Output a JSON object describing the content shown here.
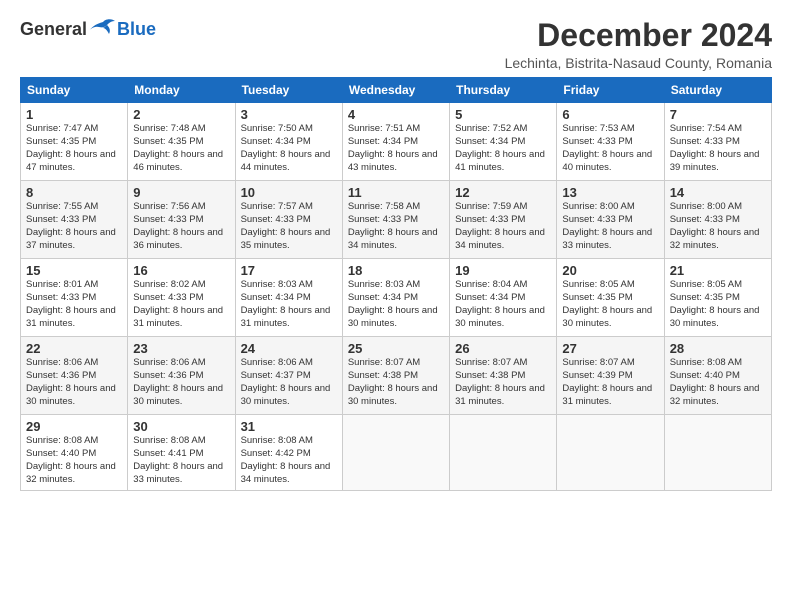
{
  "header": {
    "logo_general": "General",
    "logo_blue": "Blue",
    "month_title": "December 2024",
    "location": "Lechinta, Bistrita-Nasaud County, Romania"
  },
  "days_of_week": [
    "Sunday",
    "Monday",
    "Tuesday",
    "Wednesday",
    "Thursday",
    "Friday",
    "Saturday"
  ],
  "weeks": [
    [
      {
        "day": 1,
        "sunrise": "7:47 AM",
        "sunset": "4:35 PM",
        "daylight": "8 hours and 47 minutes."
      },
      {
        "day": 2,
        "sunrise": "7:48 AM",
        "sunset": "4:35 PM",
        "daylight": "8 hours and 46 minutes."
      },
      {
        "day": 3,
        "sunrise": "7:50 AM",
        "sunset": "4:34 PM",
        "daylight": "8 hours and 44 minutes."
      },
      {
        "day": 4,
        "sunrise": "7:51 AM",
        "sunset": "4:34 PM",
        "daylight": "8 hours and 43 minutes."
      },
      {
        "day": 5,
        "sunrise": "7:52 AM",
        "sunset": "4:34 PM",
        "daylight": "8 hours and 41 minutes."
      },
      {
        "day": 6,
        "sunrise": "7:53 AM",
        "sunset": "4:33 PM",
        "daylight": "8 hours and 40 minutes."
      },
      {
        "day": 7,
        "sunrise": "7:54 AM",
        "sunset": "4:33 PM",
        "daylight": "8 hours and 39 minutes."
      }
    ],
    [
      {
        "day": 8,
        "sunrise": "7:55 AM",
        "sunset": "4:33 PM",
        "daylight": "8 hours and 37 minutes."
      },
      {
        "day": 9,
        "sunrise": "7:56 AM",
        "sunset": "4:33 PM",
        "daylight": "8 hours and 36 minutes."
      },
      {
        "day": 10,
        "sunrise": "7:57 AM",
        "sunset": "4:33 PM",
        "daylight": "8 hours and 35 minutes."
      },
      {
        "day": 11,
        "sunrise": "7:58 AM",
        "sunset": "4:33 PM",
        "daylight": "8 hours and 34 minutes."
      },
      {
        "day": 12,
        "sunrise": "7:59 AM",
        "sunset": "4:33 PM",
        "daylight": "8 hours and 34 minutes."
      },
      {
        "day": 13,
        "sunrise": "8:00 AM",
        "sunset": "4:33 PM",
        "daylight": "8 hours and 33 minutes."
      },
      {
        "day": 14,
        "sunrise": "8:00 AM",
        "sunset": "4:33 PM",
        "daylight": "8 hours and 32 minutes."
      }
    ],
    [
      {
        "day": 15,
        "sunrise": "8:01 AM",
        "sunset": "4:33 PM",
        "daylight": "8 hours and 31 minutes."
      },
      {
        "day": 16,
        "sunrise": "8:02 AM",
        "sunset": "4:33 PM",
        "daylight": "8 hours and 31 minutes."
      },
      {
        "day": 17,
        "sunrise": "8:03 AM",
        "sunset": "4:34 PM",
        "daylight": "8 hours and 31 minutes."
      },
      {
        "day": 18,
        "sunrise": "8:03 AM",
        "sunset": "4:34 PM",
        "daylight": "8 hours and 30 minutes."
      },
      {
        "day": 19,
        "sunrise": "8:04 AM",
        "sunset": "4:34 PM",
        "daylight": "8 hours and 30 minutes."
      },
      {
        "day": 20,
        "sunrise": "8:05 AM",
        "sunset": "4:35 PM",
        "daylight": "8 hours and 30 minutes."
      },
      {
        "day": 21,
        "sunrise": "8:05 AM",
        "sunset": "4:35 PM",
        "daylight": "8 hours and 30 minutes."
      }
    ],
    [
      {
        "day": 22,
        "sunrise": "8:06 AM",
        "sunset": "4:36 PM",
        "daylight": "8 hours and 30 minutes."
      },
      {
        "day": 23,
        "sunrise": "8:06 AM",
        "sunset": "4:36 PM",
        "daylight": "8 hours and 30 minutes."
      },
      {
        "day": 24,
        "sunrise": "8:06 AM",
        "sunset": "4:37 PM",
        "daylight": "8 hours and 30 minutes."
      },
      {
        "day": 25,
        "sunrise": "8:07 AM",
        "sunset": "4:38 PM",
        "daylight": "8 hours and 30 minutes."
      },
      {
        "day": 26,
        "sunrise": "8:07 AM",
        "sunset": "4:38 PM",
        "daylight": "8 hours and 31 minutes."
      },
      {
        "day": 27,
        "sunrise": "8:07 AM",
        "sunset": "4:39 PM",
        "daylight": "8 hours and 31 minutes."
      },
      {
        "day": 28,
        "sunrise": "8:08 AM",
        "sunset": "4:40 PM",
        "daylight": "8 hours and 32 minutes."
      }
    ],
    [
      {
        "day": 29,
        "sunrise": "8:08 AM",
        "sunset": "4:40 PM",
        "daylight": "8 hours and 32 minutes."
      },
      {
        "day": 30,
        "sunrise": "8:08 AM",
        "sunset": "4:41 PM",
        "daylight": "8 hours and 33 minutes."
      },
      {
        "day": 31,
        "sunrise": "8:08 AM",
        "sunset": "4:42 PM",
        "daylight": "8 hours and 34 minutes."
      },
      null,
      null,
      null,
      null
    ]
  ]
}
